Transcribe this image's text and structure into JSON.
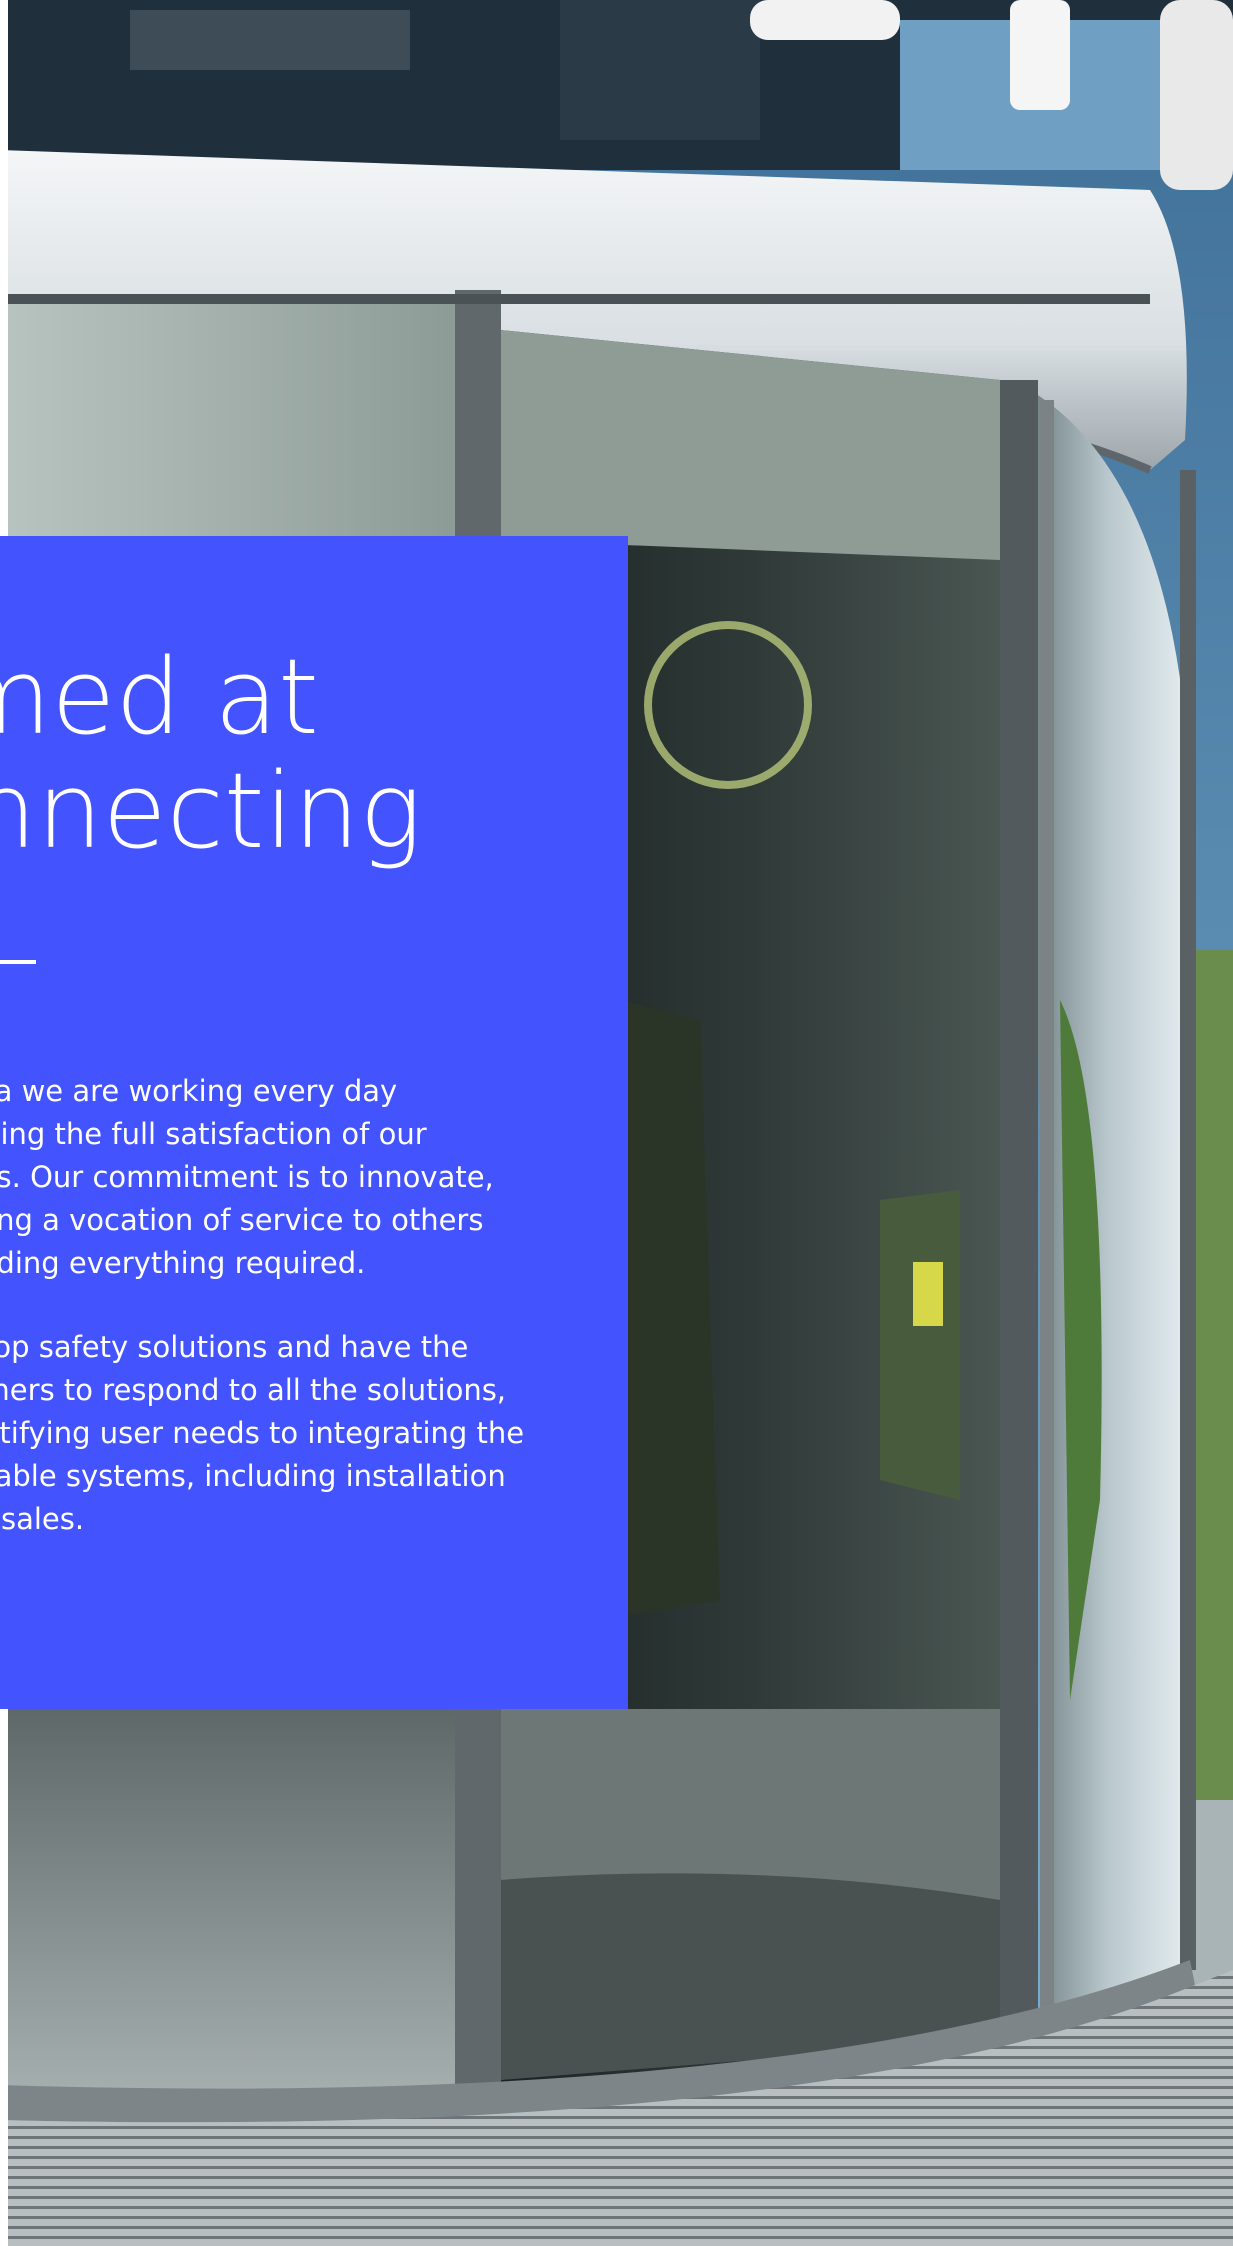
{
  "hero": {
    "heading_lines": [
      "Aimed at",
      "connecting"
    ],
    "paragraph_1_lines": [
      "At Manusa we are working every day",
      "on achieving the full satisfaction of our",
      "customers. Our commitment is to innovate,",
      "maintaining a vocation of service to others",
      "and providing everything required."
    ],
    "paragraph_2_lines": [
      "We develop safety solutions and have the",
      "best partners to respond to all the solutions,",
      "from identifying user needs to integrating the",
      "most suitable systems, including installation",
      "and after-sales."
    ]
  },
  "colors": {
    "panel": "#4353fe",
    "text": "#ffffff"
  }
}
